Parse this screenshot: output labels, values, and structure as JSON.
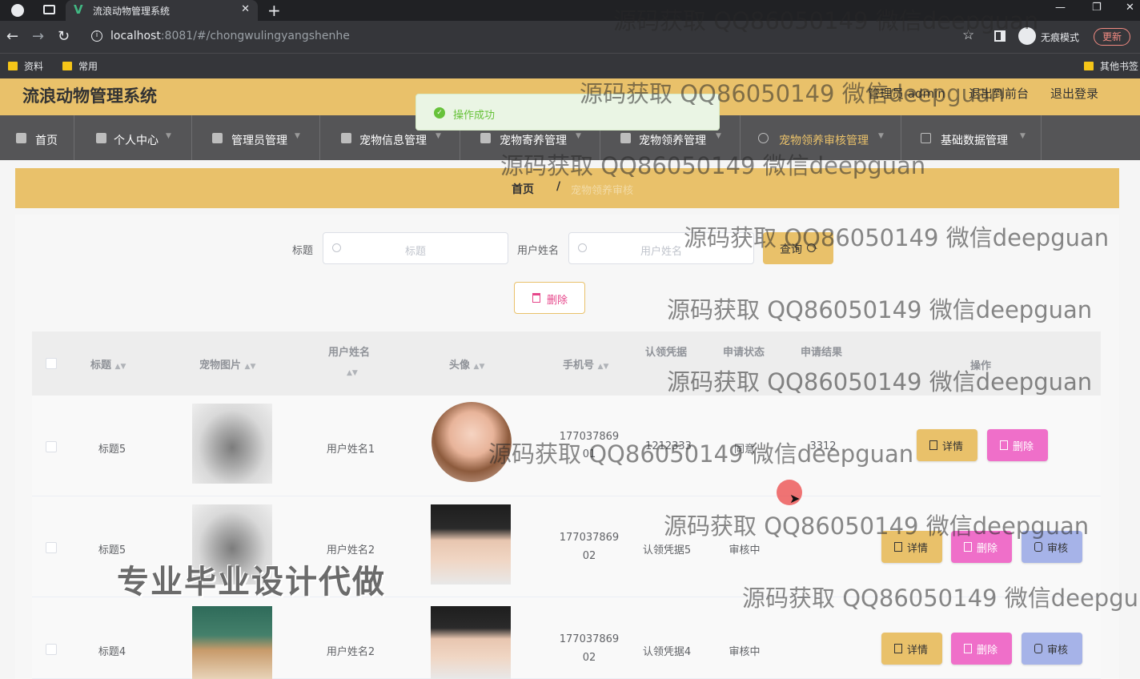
{
  "browser": {
    "tab_title": "流浪动物管理系统",
    "url_host": "localhost",
    "url_rest": ":8081/#/chongwulingyangshenhe",
    "incognito_label": "无痕模式",
    "update_label": "更新",
    "bookmarks": [
      "资料",
      "常用"
    ],
    "other_bookmarks": "其他书签"
  },
  "header": {
    "title": "流浪动物管理系统",
    "user": "管理员 admin",
    "front_link": "退出到前台",
    "logout": "退出登录"
  },
  "menu": [
    {
      "label": "首页"
    },
    {
      "label": "个人中心"
    },
    {
      "label": "管理员管理"
    },
    {
      "label": "宠物信息管理"
    },
    {
      "label": "宠物寄养管理"
    },
    {
      "label": "宠物领养管理"
    },
    {
      "label": "宠物领养审核管理"
    },
    {
      "label": "基础数据管理"
    }
  ],
  "breadcrumb": {
    "home": "首页",
    "sep": "/",
    "current": "宠物领养审核"
  },
  "toast": {
    "text": "操作成功"
  },
  "search": {
    "title_label": "标题",
    "title_placeholder": "标题",
    "user_label": "用户姓名",
    "user_placeholder": "用户姓名",
    "query_label": "查询"
  },
  "bulk_delete": "删除",
  "table": {
    "headers": {
      "title": "标题",
      "pet_image": "宠物图片",
      "user_name": "用户姓名",
      "avatar": "头像",
      "phone": "手机号",
      "proof": "认领凭据",
      "status": "申请状态",
      "result": "申请结果",
      "actions": "操作"
    },
    "rows": [
      {
        "title": "标题5",
        "user_name": "用户姓名1",
        "phone_a": "177037869",
        "phone_b": "01",
        "proof": "1212333",
        "status": "同意",
        "result": "3312",
        "detail": "详情",
        "delete": "删除"
      },
      {
        "title": "标题5",
        "user_name": "用户姓名2",
        "phone_a": "177037869",
        "phone_b": "02",
        "proof": "认领凭据5",
        "status": "审核中",
        "result": "",
        "detail": "详情",
        "delete": "删除",
        "review": "审核"
      },
      {
        "title": "标题4",
        "user_name": "用户姓名2",
        "phone_a": "177037869",
        "phone_b": "02",
        "proof": "认领凭据4",
        "status": "审核中",
        "result": "",
        "detail": "详情",
        "delete": "删除",
        "review": "审核"
      }
    ]
  },
  "watermark": "源码获取 QQ86050149 微信deepguan",
  "watermark_cut": "源码获取 QQ86050149 微信deepgu",
  "promo": "专业毕业设计代做"
}
